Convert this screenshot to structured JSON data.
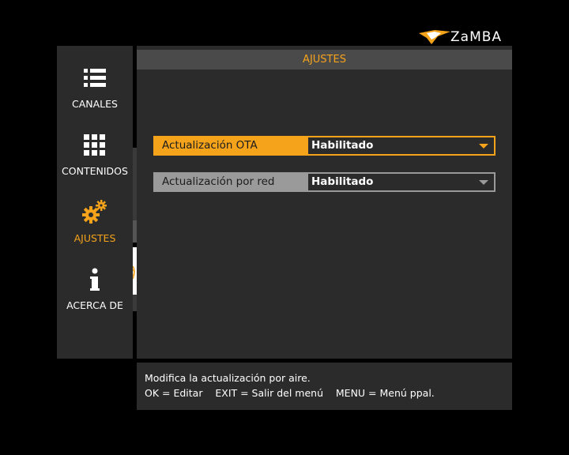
{
  "brand": {
    "name": "ZaMBA",
    "accent": "#f5a31b"
  },
  "sidebar": {
    "items": [
      {
        "label": "CANALES",
        "icon": "list-icon",
        "active": false
      },
      {
        "label": "CONTENIDOS",
        "icon": "grid-icon",
        "active": false
      },
      {
        "label": "AJUSTES",
        "icon": "gears-icon",
        "active": true
      },
      {
        "label": "ACERCA DE",
        "icon": "info-icon",
        "active": false
      }
    ]
  },
  "main": {
    "title": "AJUSTES",
    "settings": [
      {
        "label": "Actualización OTA",
        "value": "Habilitado",
        "focused": true
      },
      {
        "label": "Actualización por red",
        "value": "Habilitado",
        "focused": false
      }
    ]
  },
  "footer": {
    "description": "Modifica la actualización por aire.",
    "keys": "OK = Editar    EXIT = Salir del menú    MENU = Menú ppal."
  }
}
